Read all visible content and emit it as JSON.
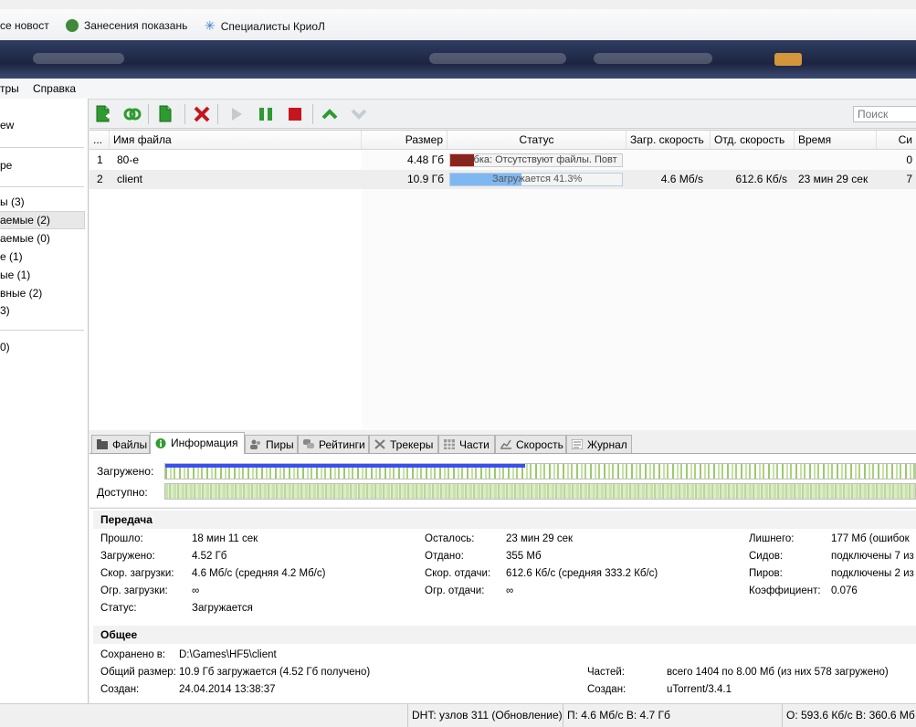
{
  "bookmarks": [
    {
      "label": "се новост",
      "color": "#2f6fc0"
    },
    {
      "label": "Занесения показань",
      "color": "#3f8a3a"
    },
    {
      "label": "Специалисты КриоЛ",
      "color": "#3a7fd0"
    }
  ],
  "menu": {
    "filters": "тры",
    "help": "Справка"
  },
  "sidebar": {
    "items": [
      {
        "label": "ew"
      },
      {
        "label": "pe"
      },
      {
        "label": "ы (3)"
      },
      {
        "label": "аемые (2)"
      },
      {
        "label": "аемые (0)"
      },
      {
        "label": "е (1)"
      },
      {
        "label": "ые (1)"
      },
      {
        "label": "вные (2)"
      },
      {
        "label": "3)"
      },
      {
        "label": "0)"
      }
    ]
  },
  "toolbar": {
    "search_placeholder": "Поиск"
  },
  "table": {
    "columns": {
      "num": "...",
      "name": "Имя файла",
      "size": "Размер",
      "status": "Статус",
      "down": "Загр. скорость",
      "up": "Отд. скорость",
      "eta": "Время",
      "seeds": "Си"
    },
    "rows": [
      {
        "num": "1",
        "name": "80-e",
        "size": "4.48 Гб",
        "status": "Ошибка: Отсутствуют файлы. Повт",
        "progress": 0.0,
        "down": "",
        "up": "",
        "eta": "",
        "seeds": "0"
      },
      {
        "num": "2",
        "name": "client",
        "size": "10.9 Гб",
        "status": "Загружается 41.3%",
        "progress": 0.413,
        "down": "4.6 Мб/s",
        "up": "612.6 Кб/s",
        "eta": "23 мин 29 сек",
        "seeds": "7"
      }
    ]
  },
  "tabs": [
    {
      "label": "Файлы",
      "icon": "folder-icon"
    },
    {
      "label": "Информация",
      "icon": "info-icon"
    },
    {
      "label": "Пиры",
      "icon": "peers-icon"
    },
    {
      "label": "Рейтинги",
      "icon": "ratings-icon"
    },
    {
      "label": "Трекеры",
      "icon": "trackers-icon"
    },
    {
      "label": "Части",
      "icon": "pieces-icon"
    },
    {
      "label": "Скорость",
      "icon": "speed-icon"
    },
    {
      "label": "Журнал",
      "icon": "log-icon"
    }
  ],
  "pieces": {
    "downloaded_label": "Загружено:",
    "available_label": "Доступно:",
    "downloaded_fraction": 0.48
  },
  "transfer": {
    "title": "Передача",
    "col1": [
      {
        "k": "Прошло:",
        "v": "18 мин 11 сек"
      },
      {
        "k": "Загружено:",
        "v": "4.52 Гб"
      },
      {
        "k": "Скор. загрузки:",
        "v": "4.6 Мб/с (средняя 4.2 Мб/с)"
      },
      {
        "k": "Огр. загрузки:",
        "v": "∞"
      },
      {
        "k": "Статус:",
        "v": "Загружается"
      }
    ],
    "col2": [
      {
        "k": "Осталось:",
        "v": "23 мин 29 сек"
      },
      {
        "k": "Отдано:",
        "v": "355 Мб"
      },
      {
        "k": "Скор. отдачи:",
        "v": "612.6 Кб/с (средняя 333.2 Кб/с)"
      },
      {
        "k": "Огр. отдачи:",
        "v": "∞"
      }
    ],
    "col3": [
      {
        "k": "Лишнего:",
        "v": "177 Мб (ошибок"
      },
      {
        "k": "Сидов:",
        "v": "подключены 7 из"
      },
      {
        "k": "Пиров:",
        "v": "подключены 2 из"
      },
      {
        "k": "Коэффициент:",
        "v": "0.076"
      }
    ]
  },
  "general": {
    "title": "Общее",
    "saved_k": "Сохранено в:",
    "saved_v": "D:\\Games\\HF5\\client",
    "total_k": "Общий размер:",
    "total_v": "10.9 Гб загружается (4.52 Гб получено)",
    "created_k": "Создан:",
    "created_v": "24.04.2014 13:38:37",
    "pieces_k": "Частей:",
    "pieces_v": "всего 1404 по 8.00 Мб (из них 578 загружено)",
    "createdby_k": "Создан:",
    "createdby_v": "uTorrent/3.4.1"
  },
  "statusbar": {
    "dht": "DHT: узлов 311 (Обновление)",
    "down": "П: 4.6 Мб/с В: 4.7 Гб",
    "up": "О: 593.6 Кб/с В: 360.6 Мб"
  },
  "colors": {
    "error": "#9b1c12",
    "progress": "#7fb8f0",
    "green": "#2e9b2e",
    "red": "#c4161c"
  }
}
